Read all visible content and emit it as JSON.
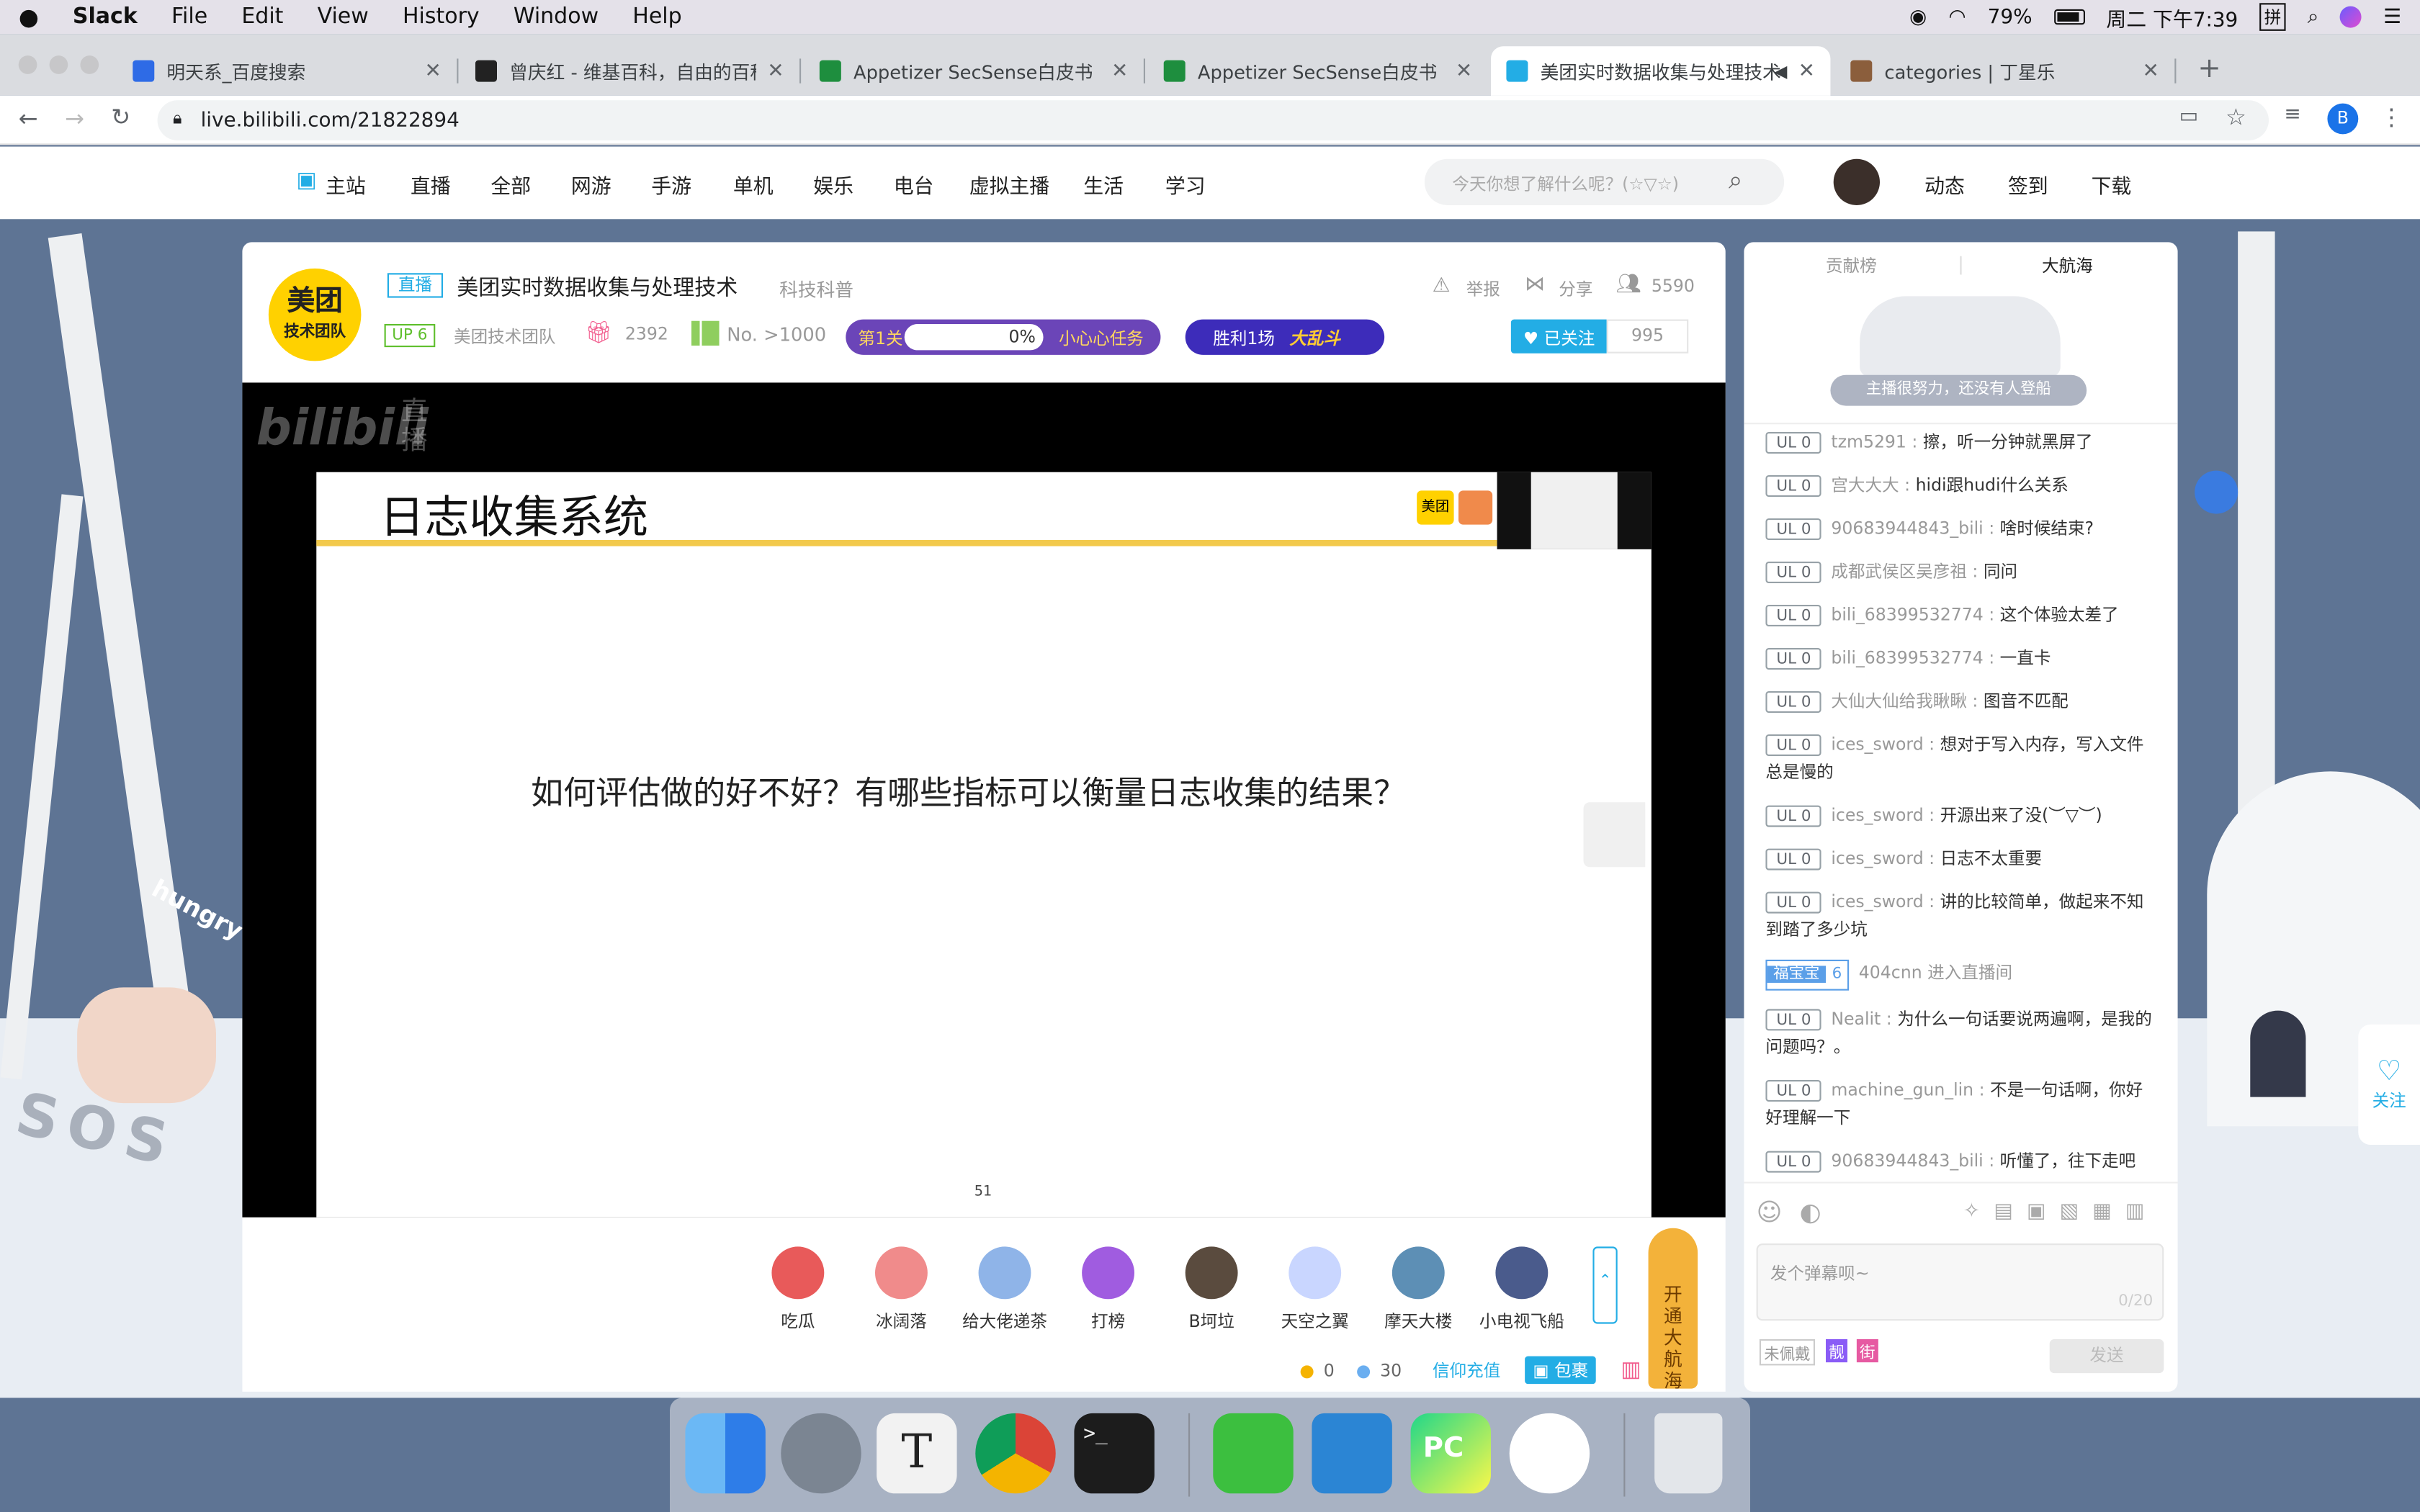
{
  "menubar": {
    "app": "Slack",
    "items": [
      "File",
      "Edit",
      "View",
      "History",
      "Window",
      "Help"
    ],
    "battery": "79%",
    "clock": "周二 下午7:39"
  },
  "tabs": [
    {
      "title": "明天系_百度搜索",
      "color": "#2e6be6"
    },
    {
      "title": "曾庆红 - 维基百科，自由的百科全书",
      "color": "#222222"
    },
    {
      "title": "Appetizer SecSense白皮书",
      "color": "#1e8e3e"
    },
    {
      "title": "Appetizer SecSense白皮书",
      "color": "#1e8e3e"
    },
    {
      "title": "美团实时数据收集与处理技术",
      "color": "#23ade5"
    },
    {
      "title": "categories | 丁星乐",
      "color": "#8b5e3c"
    }
  ],
  "address": {
    "url": "live.bilibili.com/21822894",
    "profile": "B"
  },
  "nav": {
    "items": [
      "主站",
      "直播",
      "全部",
      "网游",
      "手游",
      "单机",
      "娱乐",
      "电台",
      "虚拟主播",
      "生活",
      "学习"
    ],
    "search_placeholder": "今天你想了解什么呢？(☆▽☆)",
    "right": [
      "动态",
      "签到",
      "下载"
    ]
  },
  "room": {
    "badge": "直播",
    "title": "美团实时数据收集与处理技术",
    "category": "科技科普",
    "up_level": "UP 6",
    "up_name": "美团技术团队",
    "gifts": "2392",
    "rank": "No. >1000",
    "level": "第1关",
    "progress_text": "0%",
    "task": "小心心任务",
    "win": "胜利1场",
    "report": "举报",
    "share": "分享",
    "viewers": "5590",
    "followed": "已关注",
    "fans": "995",
    "avatar_l1": "美团",
    "avatar_l2": "技术团队"
  },
  "slide": {
    "title": "日志收集系统",
    "question": "如何评估做的好不好？有哪些指标可以衡量日志收集的结果？",
    "page": "51",
    "brand": "美团"
  },
  "watermark": {
    "logo": "bilibili",
    "sub": "直播"
  },
  "gifts": [
    "吃瓜",
    "冰阔落",
    "给大佬递茶",
    "打榜",
    "B坷垃",
    "天空之翼",
    "摩天大楼",
    "小电视飞船"
  ],
  "captain": "开通大航海",
  "wallet": {
    "gold": "0",
    "silver": "30",
    "recharge": "信仰充值",
    "package": "包裹"
  },
  "rank_tabs": [
    "贡献榜",
    "大航海"
  ],
  "empty_text": "主播很努力，还没有人登船",
  "chat": [
    {
      "lv": "UL 0",
      "user": "tzm5291",
      "text": "擦，听一分钟就黑屏了"
    },
    {
      "lv": "UL 0",
      "user": "宫大大大",
      "text": "hidi跟hudi什么关系"
    },
    {
      "lv": "UL 0",
      "user": "90683944843_bili",
      "text": "啥时候结束?"
    },
    {
      "lv": "UL 0",
      "user": "成都武侯区吴彦祖",
      "text": "同问"
    },
    {
      "lv": "UL 0",
      "user": "bili_68399532774",
      "text": "这个体验太差了"
    },
    {
      "lv": "UL 0",
      "user": "bili_68399532774",
      "text": "一直卡"
    },
    {
      "lv": "UL 0",
      "user": "大仙大仙给我瞅瞅",
      "text": "图音不匹配"
    },
    {
      "lv": "UL 0",
      "user": "ices_sword",
      "text": "想对于写入内存，写入文件总是慢的"
    },
    {
      "lv": "UL 0",
      "user": "ices_sword",
      "text": "开源出来了没(︶▽︶)"
    },
    {
      "lv": "UL 0",
      "user": "ices_sword",
      "text": "日志不太重要"
    },
    {
      "lv": "UL 0",
      "user": "ices_sword",
      "text": "讲的比较简单，做起来不知到踏了多少坑"
    },
    {
      "lv": "UL 0",
      "user": "Nealit",
      "text": "为什么一句话要说两遍啊，是我的问题吗？。"
    },
    {
      "lv": "UL 0",
      "user": "machine_gun_lin",
      "text": "不是一句话啊，你好好理解一下"
    },
    {
      "lv": "UL 0",
      "user": "90683944843_bili",
      "text": "听懂了，往下走吧"
    }
  ],
  "enter": {
    "badge": "福宝宝",
    "badge_lv": "6",
    "user": "404cnn",
    "text": "进入直播间"
  },
  "input": {
    "placeholder": "发个弹幕呗~",
    "count": "0/20",
    "send": "发送",
    "unworn": "未佩戴",
    "tag1": "靓",
    "tag2": "街"
  },
  "follow_side": "关注",
  "deco": {
    "hungry": "hungry",
    "sos": "SOS"
  }
}
